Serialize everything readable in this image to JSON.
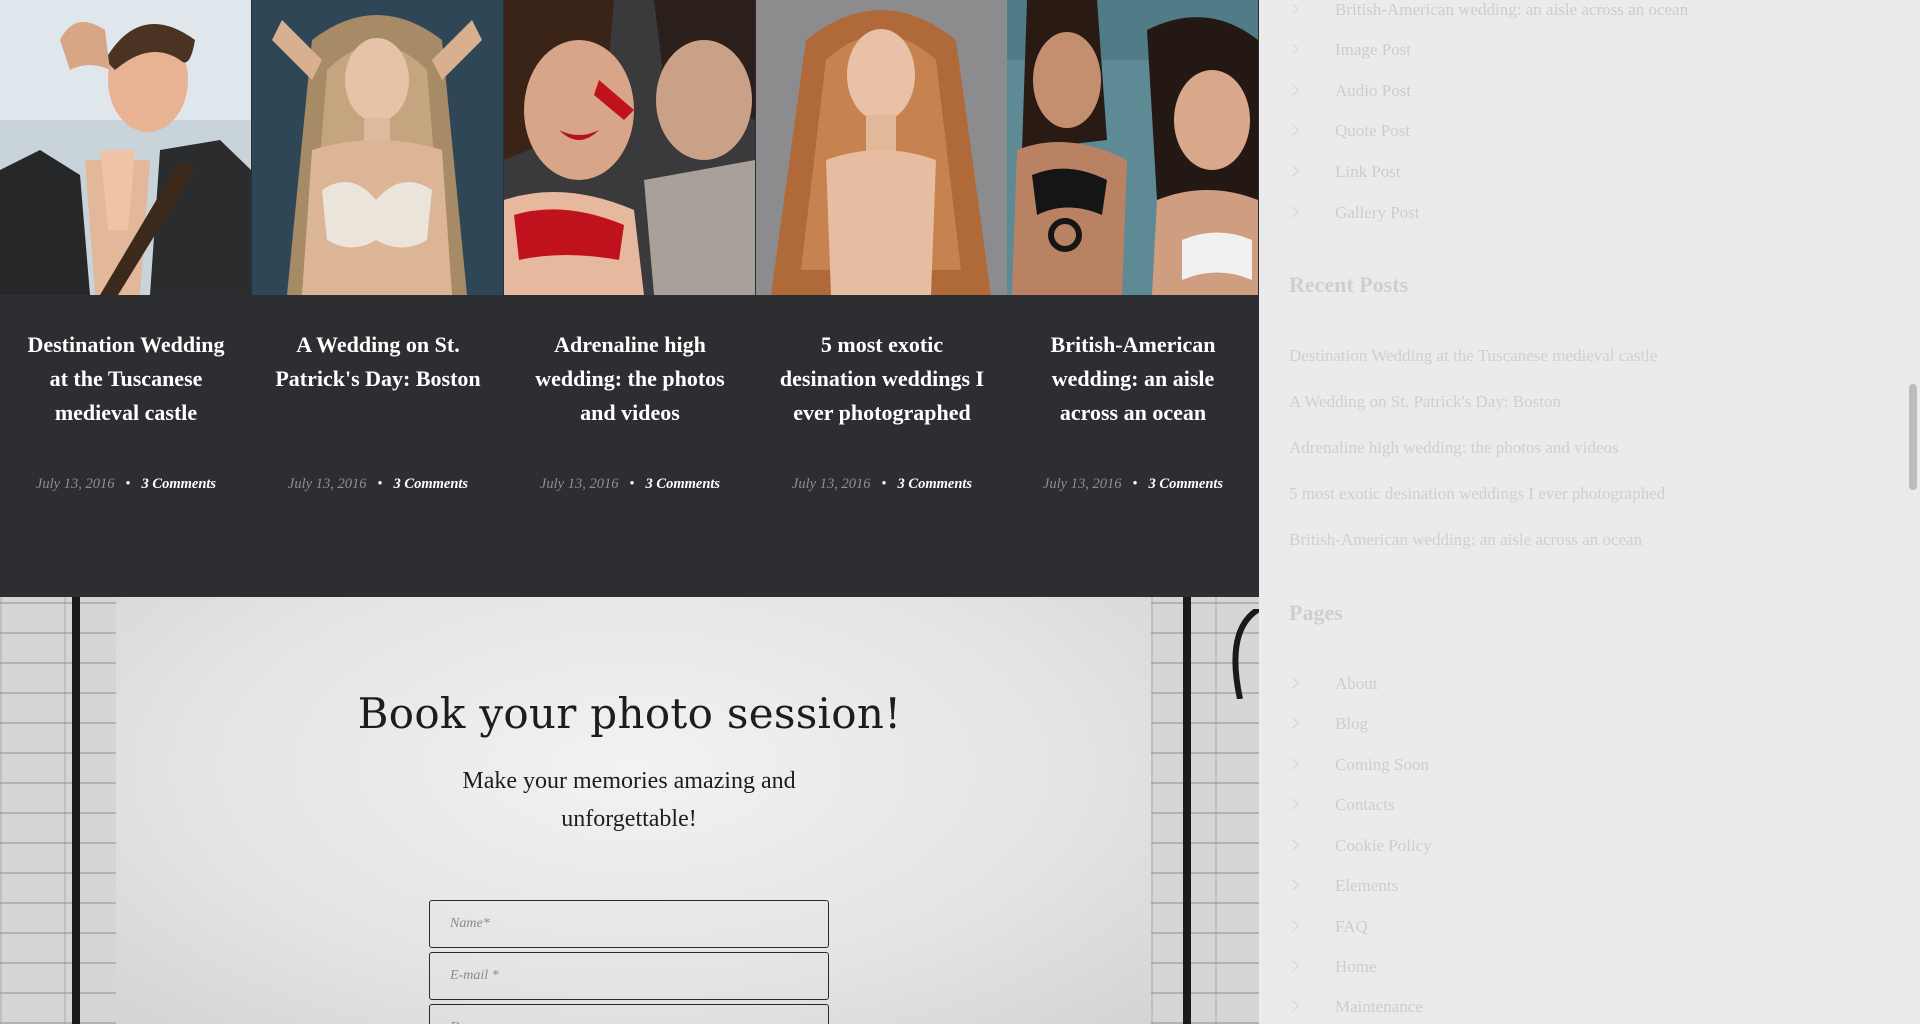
{
  "posts": [
    {
      "title": "Destination Wedding at the Tuscanese medieval castle",
      "date": "July 13, 2016",
      "comments": "3 Comments"
    },
    {
      "title": "A Wedding on St. Patrick's Day: Boston",
      "date": "July 13, 2016",
      "comments": "3 Comments"
    },
    {
      "title": "Adrenaline high wedding: the photos and videos",
      "date": "July 13, 2016",
      "comments": "3 Comments"
    },
    {
      "title": "5 most exotic desination weddings I ever photographed",
      "date": "July 13, 2016",
      "comments": "3 Comments"
    },
    {
      "title": "British-American wedding: an aisle across an ocean",
      "date": "July 13, 2016",
      "comments": "3 Comments"
    }
  ],
  "booking": {
    "title": "Book your photo session!",
    "subtitle": "Make your memories amazing and unforgettable!",
    "name_placeholder": "Name*",
    "email_placeholder": "E-mail *",
    "third_placeholder": "D..."
  },
  "sidebar": {
    "categories": [
      "British-American wedding: an aisle across an ocean",
      "Image Post",
      "Audio Post",
      "Quote Post",
      "Link Post",
      "Gallery Post"
    ],
    "recent_title": "Recent Posts",
    "recent_posts": [
      "Destination Wedding at the Tuscanese medieval castle",
      "A Wedding on St. Patrick's Day: Boston",
      "Adrenaline high wedding: the photos and videos",
      "5 most exotic desination weddings I ever photographed",
      "British-American wedding: an aisle across an ocean"
    ],
    "pages_title": "Pages",
    "pages": [
      "About",
      "Blog",
      "Coming Soon",
      "Contacts",
      "Cookie Policy",
      "Elements",
      "FAQ",
      "Home",
      "Maintenance"
    ]
  },
  "icons": {
    "list_bullet": "chevron-right-icon"
  },
  "colors": {
    "strip_bg": "#2d2e31",
    "sidebar_bg": "#ebebeb",
    "sidebar_text": "#cdcdcd"
  }
}
